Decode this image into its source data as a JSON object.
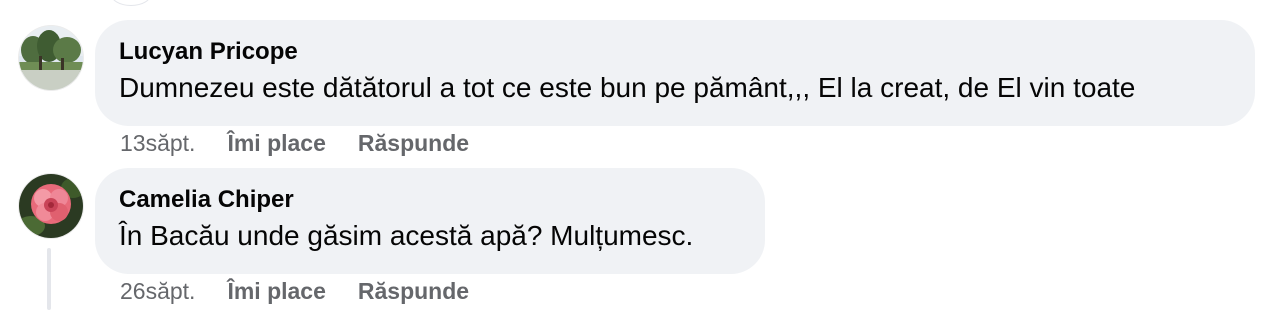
{
  "comments": [
    {
      "author": "Lucyan Pricope",
      "text": "Dumnezeu este dătătorul a tot ce este bun pe pământ,,, El la creat, de El vin toate",
      "time": "13săpt.",
      "like_label": "Îmi place",
      "reply_label": "Răspunde",
      "avatar_icon": "landscape-trees-avatar"
    },
    {
      "author": "Camelia Chiper",
      "text": "În Bacău unde găsim acestă apă? Mulțumesc.",
      "time": "26săpt.",
      "like_label": "Îmi place",
      "reply_label": "Răspunde",
      "avatar_icon": "pink-flower-avatar"
    }
  ],
  "colors": {
    "bubble": "#f0f2f5",
    "text": "#050505",
    "meta": "#65676b"
  }
}
